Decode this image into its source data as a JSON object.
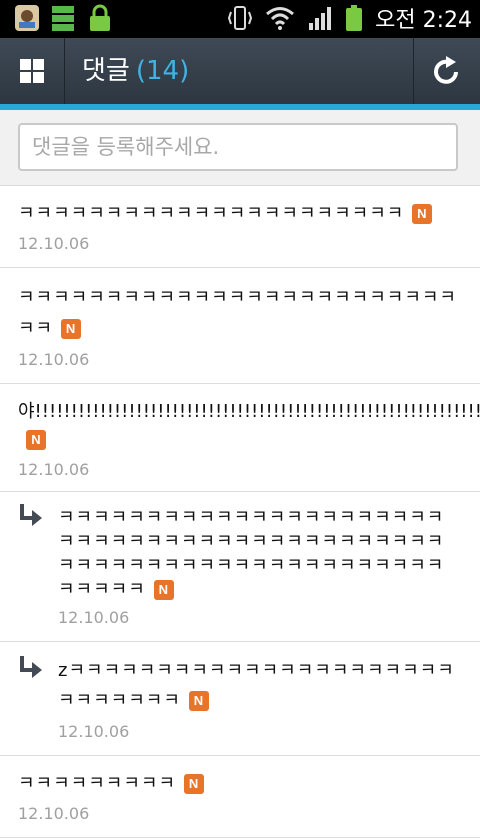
{
  "statusbar": {
    "time": "오전 2:24"
  },
  "header": {
    "title": "댓글",
    "count": "(14)"
  },
  "input": {
    "placeholder": "댓글을 등록해주세요."
  },
  "badge_label": "N",
  "comments": [
    {
      "text": "ㅋㅋㅋㅋㅋㅋㅋㅋㅋㅋㅋㅋㅋㅋㅋㅋㅋㅋㅋㅋㅋㅋ",
      "date": "12.10.06",
      "reply": false
    },
    {
      "text": "ㅋㅋㅋㅋㅋㅋㅋㅋㅋㅋㅋㅋㅋㅋㅋㅋㅋㅋㅋㅋㅋㅋㅋㅋㅋㅋㅋ",
      "date": "12.10.06",
      "reply": false
    },
    {
      "text": "야!!!!!!!!!!!!!!!!!!!!!!!!!!!!!!!!!!!!!!!!!!!!!!!!!!!!!!!!!!!!!!!!!",
      "date": "12.10.06",
      "reply": false
    },
    {
      "text": "ㅋㅋㅋㅋㅋㅋㅋㅋㅋㅋㅋㅋㅋㅋㅋㅋㅋㅋㅋㅋㅋㅋㅋㅋㅋㅋㅋㅋㅋㅋㅋㅋㅋㅋㅋㅋㅋㅋㅋㅋㅋㅋㅋㅋㅋㅋㅋㅋㅋㅋㅋㅋㅋㅋㅋㅋㅋㅋㅋㅋㅋㅋㅋㅋㅋㅋㅋㅋㅋㅋㅋ",
      "date": "12.10.06",
      "reply": true
    },
    {
      "text": "zㅋㅋㅋㅋㅋㅋㅋㅋㅋㅋㅋㅋㅋㅋㅋㅋㅋㅋㅋㅋㅋㅋㅋㅋㅋㅋㅋㅋㅋ",
      "date": "12.10.06",
      "reply": true
    },
    {
      "text": "ㅋㅋㅋㅋㅋㅋㅋㅋㅋ",
      "date": "12.10.06",
      "reply": false
    }
  ]
}
